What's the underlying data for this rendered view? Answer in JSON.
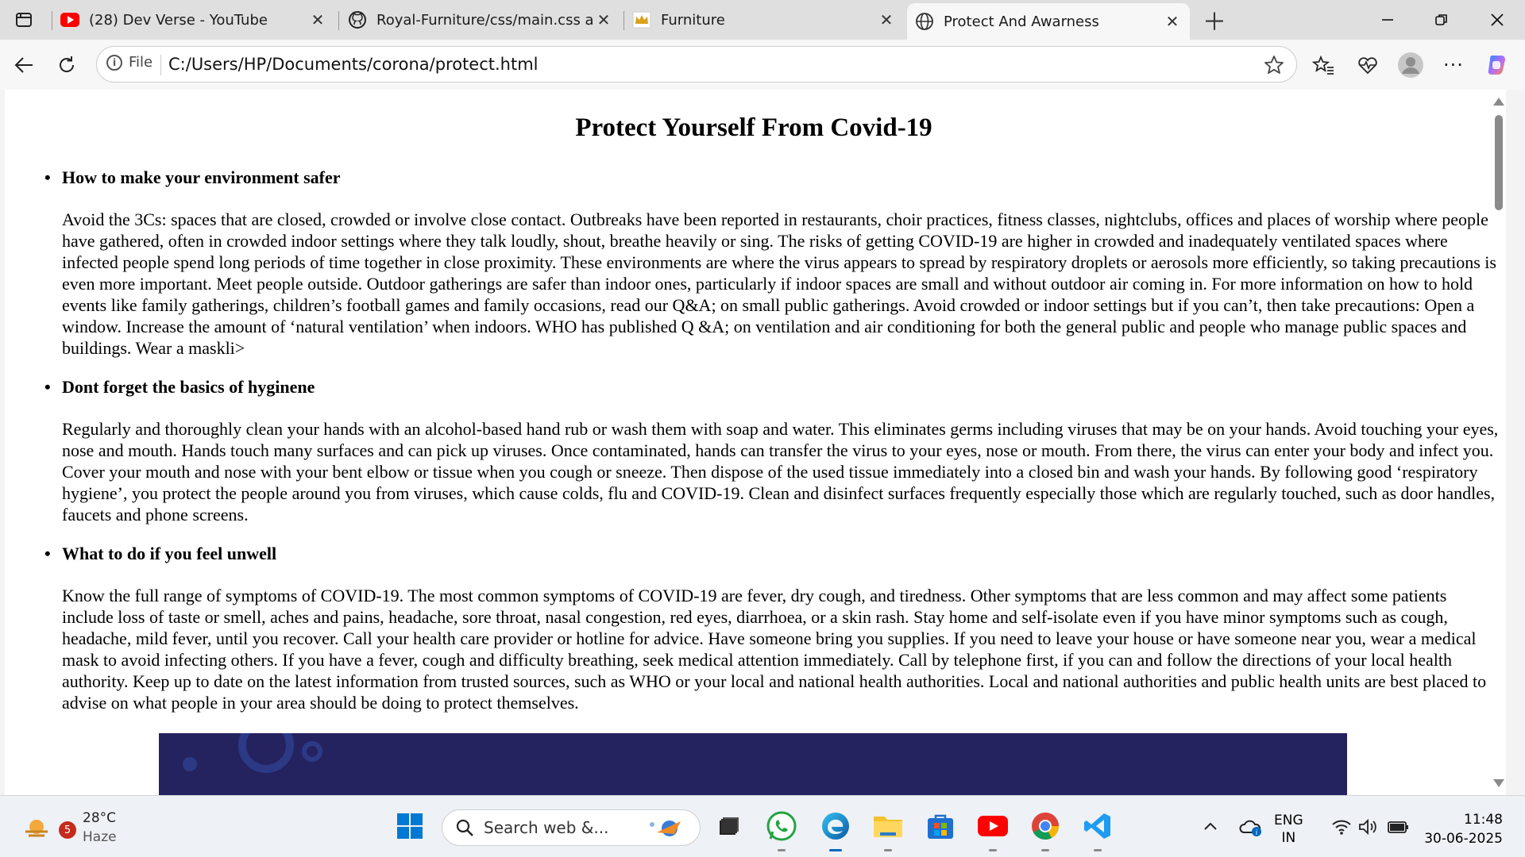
{
  "browser": {
    "tabs": [
      {
        "title": "(28) Dev Verse - YouTube",
        "icon": "youtube-icon"
      },
      {
        "title": "Royal-Furniture/css/main.css at m",
        "icon": "github-icon"
      },
      {
        "title": "Furniture",
        "icon": "crown-icon"
      },
      {
        "title": "Protect And Awarness",
        "icon": "globe-icon",
        "active": true
      }
    ],
    "address": {
      "scheme_label": "File",
      "url": "C:/Users/HP/Documents/corona/protect.html"
    }
  },
  "page": {
    "title": "Protect Yourself From Covid-19",
    "sections": [
      {
        "heading": "How to make your environment safer",
        "body": "Avoid the 3Cs: spaces that are closed, crowded or involve close contact. Outbreaks have been reported in restaurants, choir practices, fitness classes, nightclubs, offices and places of worship where people have gathered, often in crowded indoor settings where they talk loudly, shout, breathe heavily or sing. The risks of getting COVID-19 are higher in crowded and inadequately ventilated spaces where infected people spend long periods of time together in close proximity. These environments are where the virus appears to spread by respiratory droplets or aerosols more efficiently, so taking precautions is even more important. Meet people outside. Outdoor gatherings are safer than indoor ones, particularly if indoor spaces are small and without outdoor air coming in. For more information on how to hold events like family gatherings, children’s football games and family occasions, read our Q&A; on small public gatherings. Avoid crowded or indoor settings but if you can’t, then take precautions: Open a window. Increase the amount of ‘natural ventilation’ when indoors. WHO has published Q &A; on ventilation and air conditioning for both the general public and people who manage public spaces and buildings. Wear a maskli>"
      },
      {
        "heading": "Dont forget the basics of hyginene",
        "body": "Regularly and thoroughly clean your hands with an alcohol-based hand rub or wash them with soap and water. This eliminates germs including viruses that may be on your hands. Avoid touching your eyes, nose and mouth. Hands touch many surfaces and can pick up viruses. Once contaminated, hands can transfer the virus to your eyes, nose or mouth. From there, the virus can enter your body and infect you. Cover your mouth and nose with your bent elbow or tissue when you cough or sneeze. Then dispose of the used tissue immediately into a closed bin and wash your hands. By following good ‘respiratory hygiene’, you protect the people around you from viruses, which cause colds, flu and COVID-19. Clean and disinfect surfaces frequently especially those which are regularly touched, such as door handles, faucets and phone screens."
      },
      {
        "heading": "What to do if you feel unwell",
        "body": "Know the full range of symptoms of COVID-19. The most common symptoms of COVID-19 are fever, dry cough, and tiredness. Other symptoms that are less common and may affect some patients include loss of taste or smell, aches and pains, headache, sore throat, nasal congestion, red eyes, diarrhoea, or a skin rash. Stay home and self-isolate even if you have minor symptoms such as cough, headache, mild fever, until you recover. Call your health care provider or hotline for advice. Have someone bring you supplies. If you need to leave your house or have someone near you, wear a medical mask to avoid infecting others. If you have a fever, cough and difficulty breathing, seek medical attention immediately. Call by telephone first, if you can and follow the directions of your local health authority. Keep up to date on the latest information from trusted sources, such as WHO or your local and national health authorities. Local and national authorities and public health units are best placed to advise on what people in your area should be doing to protect themselves."
      }
    ]
  },
  "taskbar": {
    "weather": {
      "badge": "5",
      "temp": "28°C",
      "condition": "Haze"
    },
    "search_placeholder": "Search web &...",
    "language": {
      "line1": "ENG",
      "line2": "IN"
    },
    "clock": {
      "time": "11:48",
      "date": "30-06-2025"
    },
    "apps": [
      "windows-start-icon",
      "task-view-icon",
      "whatsapp-icon",
      "edge-icon",
      "file-explorer-icon",
      "microsoft-store-icon",
      "youtube-icon",
      "chrome-icon",
      "vscode-icon"
    ]
  },
  "colors": {
    "banner": "#252260",
    "youtube": "#ff0000",
    "edge_accent": "#0067c0"
  }
}
